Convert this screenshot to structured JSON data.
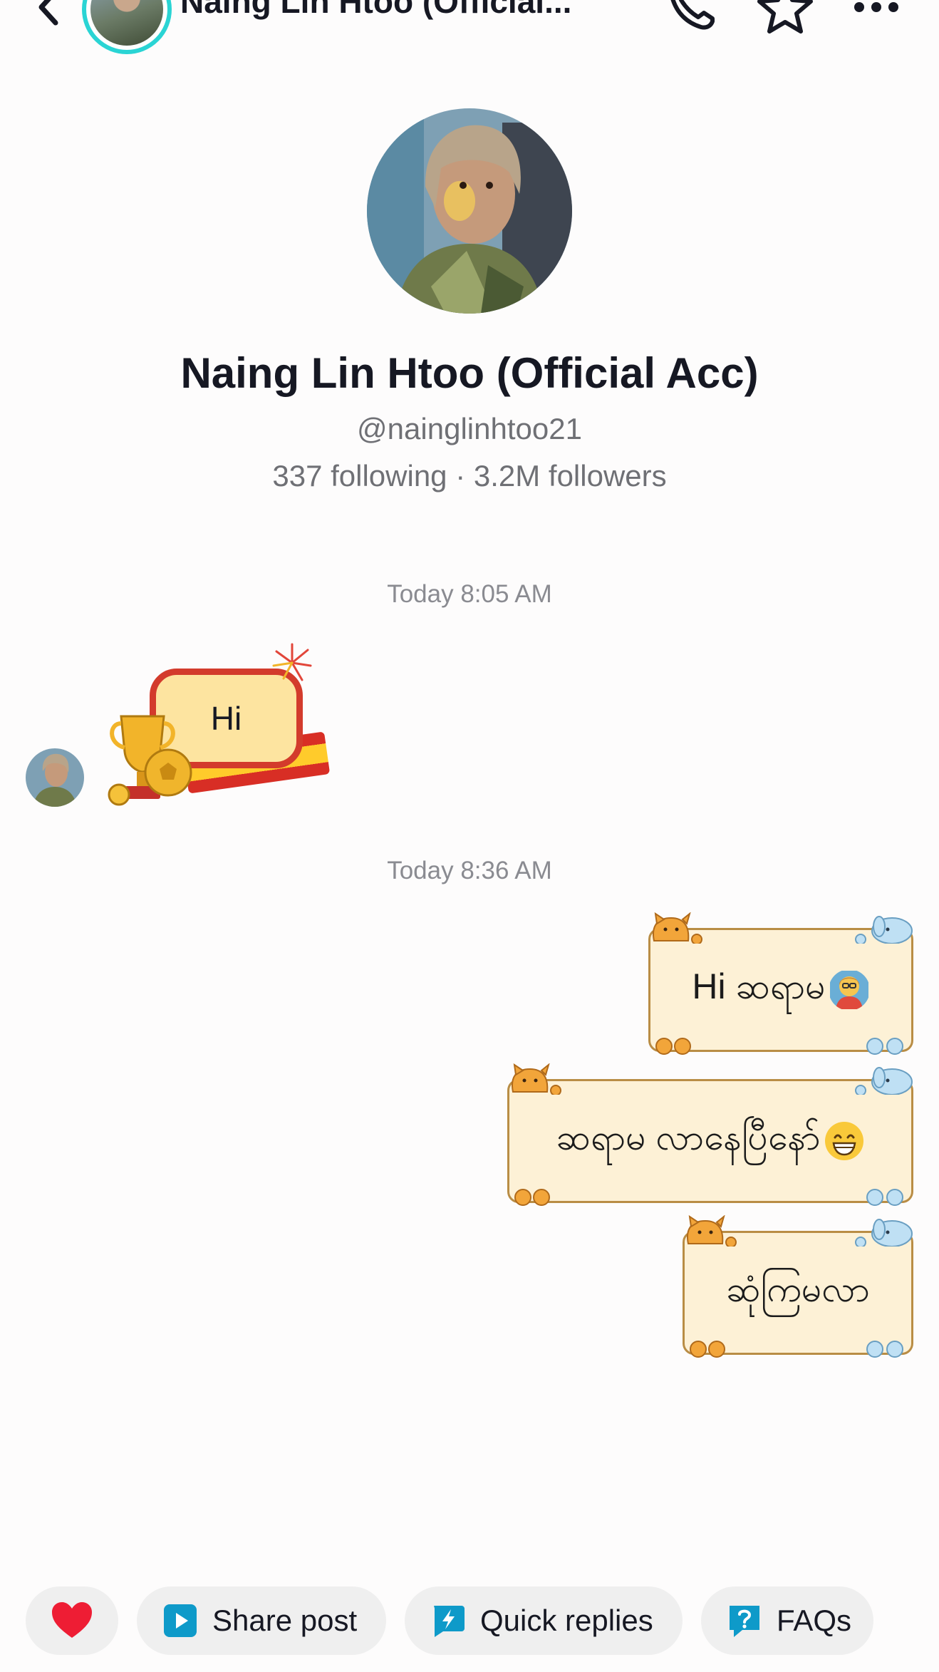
{
  "header": {
    "title": "Naing Lin Htoo (Official...",
    "back_icon": "chevron-left-icon",
    "call_icon": "phone-icon",
    "favorite_icon": "star-icon",
    "more_icon": "more-horizontal-icon",
    "avatar_ring_color": "#2ad4d4"
  },
  "profile": {
    "name": "Naing Lin Htoo (Official Acc)",
    "handle": "@nainglinhtoo21",
    "stats": "337 following · 3.2M followers"
  },
  "messages": [
    {
      "timestamp": "Today 8:05 AM"
    },
    {
      "direction": "incoming",
      "type": "sticker",
      "text": "Hi"
    },
    {
      "timestamp": "Today 8:36 AM"
    },
    {
      "direction": "outgoing",
      "type": "sticker",
      "text": "Hi ဆရာမ",
      "emoji": "teacher-emoji"
    },
    {
      "direction": "outgoing",
      "type": "sticker",
      "text": "ဆရာမ လာနေပြီနော်",
      "emoji": "grinning-face-emoji"
    },
    {
      "direction": "outgoing",
      "type": "sticker",
      "text": "ဆုံကြမလာ"
    }
  ],
  "quick_actions": {
    "heart_icon": "heart-icon",
    "share_post": "Share post",
    "quick_replies": "Quick replies",
    "faqs": "FAQs"
  },
  "colors": {
    "accent": "#0e9ac9",
    "heart": "#ee1d34",
    "sticker_paper": "#fdf1d6",
    "sticker_border": "#b98d45"
  }
}
